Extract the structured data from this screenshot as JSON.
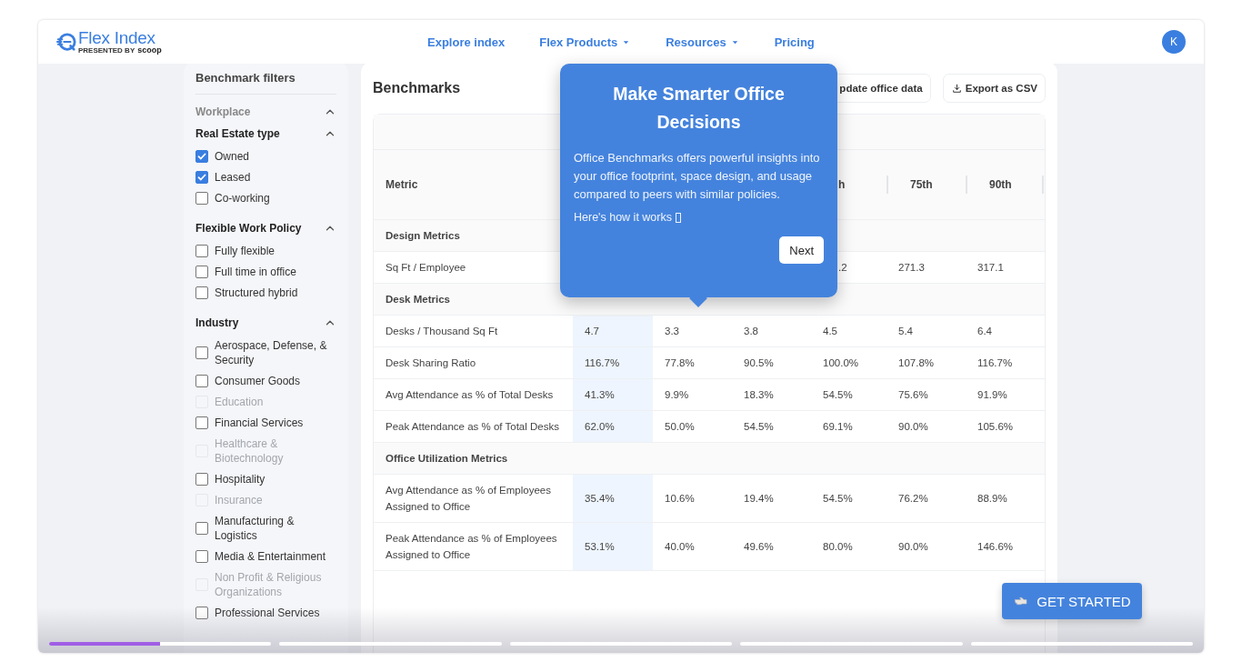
{
  "header": {
    "logo": {
      "name": "Flex Index",
      "tagline": "PRESENTED BY",
      "brand": "scoop"
    },
    "nav": [
      {
        "label": "Explore index",
        "dropdown": false
      },
      {
        "label": "Flex Products",
        "dropdown": true
      },
      {
        "label": "Resources",
        "dropdown": true
      },
      {
        "label": "Pricing",
        "dropdown": false
      }
    ],
    "avatar": "K"
  },
  "sidebar": {
    "title": "Benchmark filters",
    "sections": [
      {
        "kind": "category",
        "title": "Workplace",
        "expanded": true
      },
      {
        "kind": "group",
        "title": "Real Estate type",
        "expanded": true,
        "options": [
          {
            "label": "Owned",
            "checked": true,
            "disabled": false
          },
          {
            "label": "Leased",
            "checked": true,
            "disabled": false
          },
          {
            "label": "Co-working",
            "checked": false,
            "disabled": false
          }
        ]
      },
      {
        "kind": "group",
        "title": "Flexible Work Policy",
        "expanded": true,
        "options": [
          {
            "label": "Fully flexible",
            "checked": false,
            "disabled": false
          },
          {
            "label": "Full time in office",
            "checked": false,
            "disabled": false
          },
          {
            "label": "Structured hybrid",
            "checked": false,
            "disabled": false
          }
        ]
      },
      {
        "kind": "group",
        "title": "Industry",
        "expanded": true,
        "options": [
          {
            "label": "Aerospace, Defense, & Security",
            "checked": false,
            "disabled": false
          },
          {
            "label": "Consumer Goods",
            "checked": false,
            "disabled": false
          },
          {
            "label": "Education",
            "checked": false,
            "disabled": true
          },
          {
            "label": "Financial Services",
            "checked": false,
            "disabled": false
          },
          {
            "label": "Healthcare & Biotechnology",
            "checked": false,
            "disabled": true
          },
          {
            "label": "Hospitality",
            "checked": false,
            "disabled": false
          },
          {
            "label": "Insurance",
            "checked": false,
            "disabled": true
          },
          {
            "label": "Manufacturing & Logistics",
            "checked": false,
            "disabled": false
          },
          {
            "label": "Media & Entertainment",
            "checked": false,
            "disabled": false
          },
          {
            "label": "Non Profit & Religious Organizations",
            "checked": false,
            "disabled": true
          },
          {
            "label": "Professional Services",
            "checked": false,
            "disabled": false
          }
        ]
      }
    ]
  },
  "main": {
    "title": "Benchmarks",
    "buttons": [
      {
        "label": "pdate office data"
      },
      {
        "label": "Export as CSV"
      }
    ],
    "table": {
      "columns": [
        {
          "label": "Metric",
          "highlight": false
        },
        {
          "highlight": true
        },
        {
          "highlight": false
        },
        {
          "highlight": false
        },
        {
          "label": "h",
          "highlight": false
        },
        {
          "label": "75th",
          "highlight": false
        },
        {
          "label": "90th",
          "highlight": false
        }
      ],
      "rows": [
        {
          "kind": "group",
          "label": "Design Metrics"
        },
        {
          "kind": "data",
          "label": "Sq Ft / Employee",
          "cells": [
            null,
            null,
            null,
            ".2",
            "271.3",
            "317.1"
          ]
        },
        {
          "kind": "group",
          "label": "Desk Metrics"
        },
        {
          "kind": "data",
          "label": "Desks / Thousand Sq Ft",
          "cells": [
            "4.7",
            "3.3",
            "3.8",
            "4.5",
            "5.4",
            "6.4"
          ]
        },
        {
          "kind": "data",
          "label": "Desk Sharing Ratio",
          "cells": [
            "116.7%",
            "77.8%",
            "90.5%",
            "100.0%",
            "107.8%",
            "116.7%"
          ]
        },
        {
          "kind": "data",
          "label": "Avg Attendance as % of Total Desks",
          "cells": [
            "41.3%",
            "9.9%",
            "18.3%",
            "54.5%",
            "75.6%",
            "91.9%"
          ]
        },
        {
          "kind": "data",
          "label": "Peak Attendance as % of Total Desks",
          "cells": [
            "62.0%",
            "50.0%",
            "54.5%",
            "69.1%",
            "90.0%",
            "105.6%"
          ]
        },
        {
          "kind": "group",
          "label": "Office Utilization Metrics"
        },
        {
          "kind": "data",
          "label": "Avg Attendance as % of Employees Assigned to Office",
          "cells": [
            "35.4%",
            "10.6%",
            "19.4%",
            "54.5%",
            "76.2%",
            "88.9%"
          ]
        },
        {
          "kind": "data",
          "label": "Peak Attendance as % of Employees Assigned to Office",
          "cells": [
            "53.1%",
            "40.0%",
            "49.6%",
            "80.0%",
            "90.0%",
            "146.6%"
          ]
        }
      ]
    }
  },
  "popover": {
    "title": "Make Smarter Office Decisions",
    "body": "Office Benchmarks offers powerful insights into your office footprint, space design, and usage compared to peers with similar policies.",
    "link": "Here's how it works",
    "button": "Next"
  },
  "cta": {
    "label": "GET STARTED"
  },
  "progress": [
    {
      "level": 0.5
    },
    {
      "level": 0
    },
    {
      "level": 0
    },
    {
      "level": 0
    },
    {
      "level": 0
    }
  ]
}
